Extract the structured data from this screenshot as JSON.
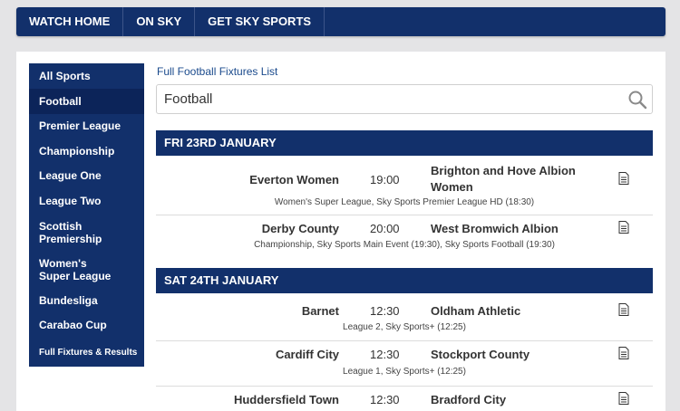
{
  "topnav": {
    "tabs": [
      "WATCH HOME",
      "ON SKY",
      "GET SKY SPORTS"
    ]
  },
  "sidebar": {
    "items": [
      "All Sports",
      "Football",
      "Premier League",
      "Championship",
      "League One",
      "League Two",
      "Scottish Premiership",
      "Women's Super League",
      "Bundesliga",
      "Carabao Cup",
      "Full Fixtures & Results"
    ],
    "active": "Football"
  },
  "main": {
    "full_link": "Full Football Fixtures List",
    "search_value": "Football",
    "search_icon": "magnifier-icon",
    "days": [
      {
        "label": "FRI 23RD JANUARY",
        "fixtures": [
          {
            "home": "Everton Women",
            "time": "19:00",
            "away": "Brighton and Hove Albion Women",
            "details": "Women's Super League, Sky Sports Premier League HD (18:30)"
          },
          {
            "home": "Derby County",
            "time": "20:00",
            "away": "West Bromwich Albion",
            "details": "Championship, Sky Sports Main Event (19:30), Sky Sports Football (19:30)"
          }
        ]
      },
      {
        "label": "SAT 24TH JANUARY",
        "fixtures": [
          {
            "home": "Barnet",
            "time": "12:30",
            "away": "Oldham Athletic",
            "details": "League 2, Sky Sports+ (12:25)"
          },
          {
            "home": "Cardiff City",
            "time": "12:30",
            "away": "Stockport County",
            "details": "League 1, Sky Sports+ (12:25)"
          },
          {
            "home": "Huddersfield Town",
            "time": "12:30",
            "away": "Bradford City",
            "details": ""
          }
        ]
      }
    ]
  },
  "colors": {
    "navy": "#12306b",
    "active_navy": "#0c2459",
    "link": "#1a4a8c"
  }
}
